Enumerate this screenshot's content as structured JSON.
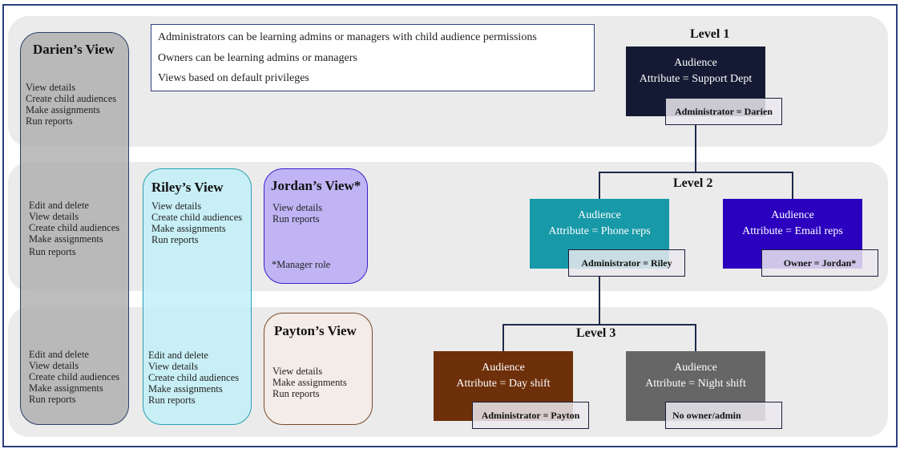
{
  "notes": [
    "Administrators can be learning admins or managers with child audience permissions",
    "Owners can be learning admins or managers",
    "Views based on default privileges"
  ],
  "views": {
    "darien": {
      "title": "Darien’s View",
      "level1": [
        "View details",
        "Create child audiences",
        "Make assignments",
        "Run reports"
      ],
      "level2": [
        "Edit and delete",
        "View details",
        "Create child audiences",
        "Make assignments",
        "Run reports"
      ],
      "level3": [
        "Edit and delete",
        "View details",
        "Create child audiences",
        "Make assignments",
        "Run reports"
      ]
    },
    "riley": {
      "title": "Riley’s View",
      "level2": [
        "View details",
        "Create child audiences",
        "Make assignments",
        "Run reports"
      ],
      "level3": [
        "Edit and delete",
        "View details",
        "Create child audiences",
        "Make assignments",
        "Run reports"
      ]
    },
    "jordan": {
      "title": "Jordan’s View*",
      "level2": [
        "View details",
        "Run reports"
      ],
      "footnote": "*Manager role"
    },
    "payton": {
      "title": "Payton’s View",
      "level3": [
        "View details",
        "Make assignments",
        "Run reports"
      ]
    }
  },
  "levels": [
    "Level 1",
    "Level 2",
    "Level 3"
  ],
  "audiences": {
    "support": {
      "title": "Audience",
      "attribute": "Attribute = Support Dept",
      "tag": "Administrator = Darien",
      "color": "#141a33"
    },
    "phone": {
      "title": "Audience",
      "attribute": "Attribute = Phone reps",
      "tag": "Administrator = Riley",
      "color": "#1899a8"
    },
    "email": {
      "title": "Audience",
      "attribute": "Attribute = Email reps",
      "tag": "Owner = Jordan*",
      "color": "#2b00bf"
    },
    "day": {
      "title": "Audience",
      "attribute": "Attribute = Day shift",
      "tag": "Administrator = Payton",
      "color": "#6e300a"
    },
    "night": {
      "title": "Audience",
      "attribute": "Attribute = Night shift",
      "tag": "No owner/admin",
      "color": "#666666"
    }
  }
}
